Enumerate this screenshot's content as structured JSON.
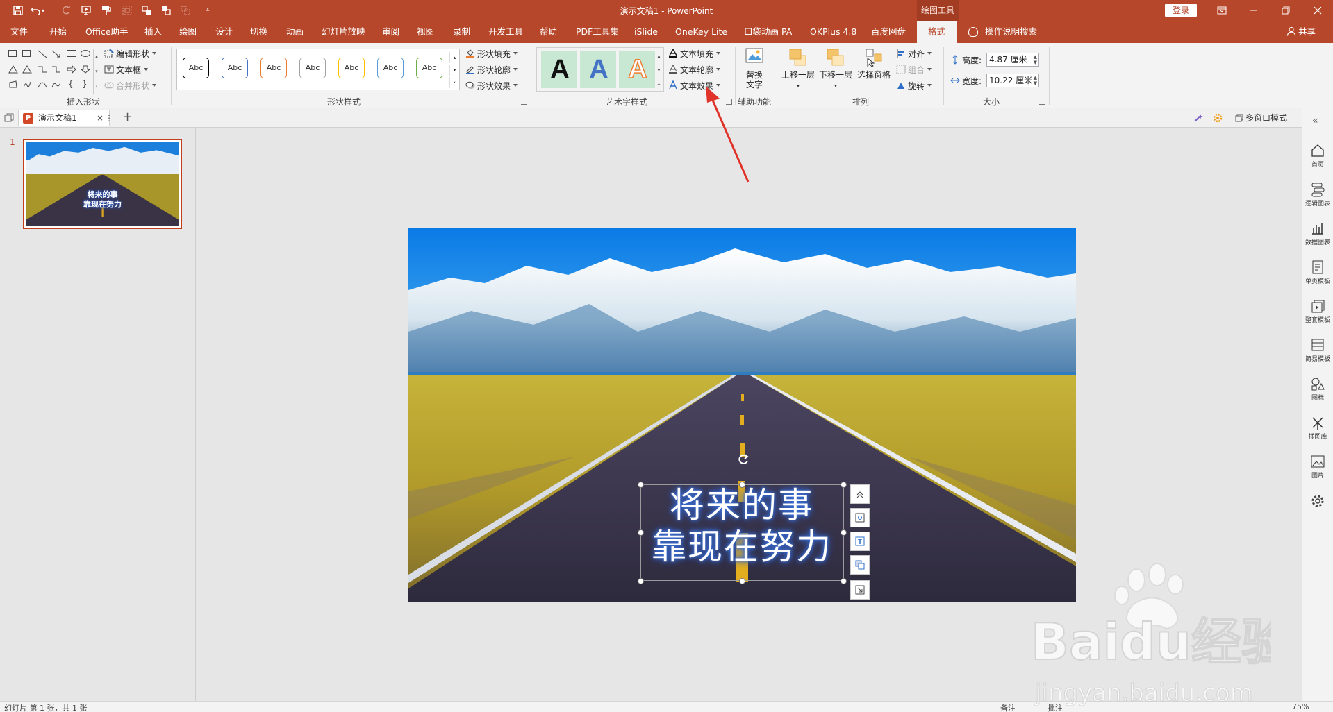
{
  "titlebar": {
    "title": "演示文稿1  -  PowerPoint",
    "context_tab": "绘图工具",
    "login_label": "登录"
  },
  "tabs": [
    "文件",
    "开始",
    "Office助手",
    "插入",
    "绘图",
    "设计",
    "切换",
    "动画",
    "幻灯片放映",
    "审阅",
    "视图",
    "录制",
    "开发工具",
    "帮助",
    "PDF工具集",
    "iSlide",
    "OneKey Lite",
    "口袋动画 PA",
    "OKPlus 4.8",
    "百度网盘",
    "格式"
  ],
  "tell_me": "操作说明搜索",
  "share_label": "共享",
  "ribbon": {
    "insert_shapes": {
      "label": "插入形状",
      "edit_shape": "编辑形状",
      "text_box": "文本框",
      "merge_shapes": "合并形状"
    },
    "shape_styles": {
      "label": "形状样式",
      "swatch_text": "Abc",
      "shape_fill": "形状填充",
      "shape_outline": "形状轮廓",
      "shape_effects": "形状效果"
    },
    "wordart_styles": {
      "label": "艺术字样式",
      "letter": "A",
      "text_fill": "文本填充",
      "text_outline": "文本轮廓",
      "text_effects": "文本效果"
    },
    "accessibility": {
      "label": "辅助功能",
      "alt_text_1": "替换",
      "alt_text_2": "文字"
    },
    "arrange": {
      "label": "排列",
      "bring_forward": "上移一层",
      "send_backward": "下移一层",
      "selection_pane": "选择窗格",
      "align": "对齐",
      "group": "组合",
      "rotate": "旋转"
    },
    "size": {
      "label": "大小",
      "height_label": "高度:",
      "height_value": "4.87 厘米",
      "width_label": "宽度:",
      "width_value": "10.22 厘米"
    }
  },
  "doc_tab": {
    "name": "演示文稿1",
    "multi_window": "多窗口模式"
  },
  "thumbnail": {
    "number": "1",
    "line1": "将来的事",
    "line2": "靠现在努力"
  },
  "slide": {
    "line1": "将来的事",
    "line2": "靠现在努力"
  },
  "rightrail": [
    "首页",
    "逻辑图表",
    "数据图表",
    "单页模板",
    "整套模板",
    "简易模板",
    "图标",
    "插图库",
    "图片"
  ],
  "statusbar": {
    "slide_info": "幻灯片 第 1 张，共 1 张",
    "notes": "备注",
    "comments": "批注",
    "zoom": "75%"
  },
  "watermark": {
    "brand": "Baidu经验",
    "url": "jingyan.baidu.com"
  },
  "colors": {
    "accent": "#b7472a",
    "ribbon": "#f3f3f3",
    "annotation": "#e0342b"
  }
}
